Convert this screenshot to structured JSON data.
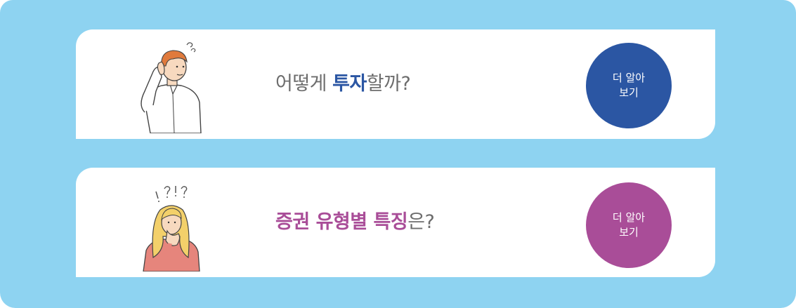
{
  "theme": {
    "background": "#8ed3f1",
    "card": "#ffffff",
    "text_gray": "#6d6d6d",
    "blue_accent": "#2b56a3",
    "purple_accent": "#a94d98"
  },
  "cards": [
    {
      "illustration": "man-listening-icon",
      "headline_prefix": "어떻게 ",
      "headline_highlight": "투자",
      "headline_suffix": "할까?",
      "button_line1": "더 알아",
      "button_line2": "보기"
    },
    {
      "illustration": "woman-thinking-icon",
      "headline_highlight": "증권 유형별 특징",
      "headline_suffix": "은?",
      "button_line1": "더 알아",
      "button_line2": "보기"
    }
  ]
}
